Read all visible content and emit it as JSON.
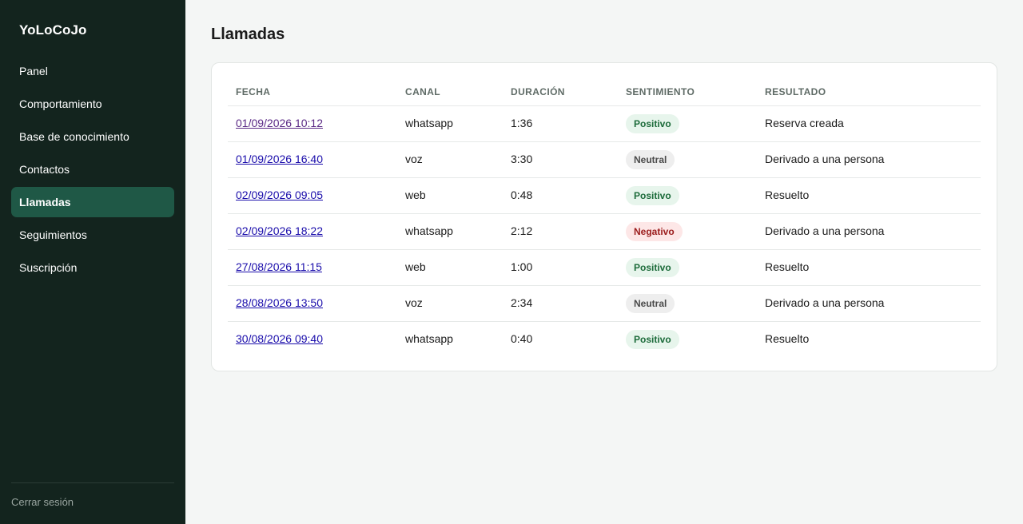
{
  "app": {
    "brand": "YoLoCoJo"
  },
  "sidebar": {
    "items": [
      {
        "label": "Panel",
        "active": false
      },
      {
        "label": "Comportamiento",
        "active": false
      },
      {
        "label": "Base de conocimiento",
        "active": false
      },
      {
        "label": "Contactos",
        "active": false
      },
      {
        "label": "Llamadas",
        "active": true
      },
      {
        "label": "Seguimientos",
        "active": false
      },
      {
        "label": "Suscripción",
        "active": false
      }
    ],
    "logout_label": "Cerrar sesión"
  },
  "main": {
    "title": "Llamadas",
    "table": {
      "headers": [
        "FECHA",
        "CANAL",
        "DURACIÓN",
        "SENTIMIENTO",
        "RESULTADO"
      ],
      "rows": [
        {
          "fecha": "01/09/2026 10:12",
          "canal": "whatsapp",
          "duracion": "1:36",
          "sentimiento": "Positivo",
          "resultado": "Reserva creada"
        },
        {
          "fecha": "01/09/2026 16:40",
          "canal": "voz",
          "duracion": "3:30",
          "sentimiento": "Neutral",
          "resultado": "Derivado a una persona"
        },
        {
          "fecha": "02/09/2026 09:05",
          "canal": "web",
          "duracion": "0:48",
          "sentimiento": "Positivo",
          "resultado": "Resuelto"
        },
        {
          "fecha": "02/09/2026 18:22",
          "canal": "whatsapp",
          "duracion": "2:12",
          "sentimiento": "Negativo",
          "resultado": "Derivado a una persona"
        },
        {
          "fecha": "27/08/2026 11:15",
          "canal": "web",
          "duracion": "1:00",
          "sentimiento": "Positivo",
          "resultado": "Resuelto"
        },
        {
          "fecha": "28/08/2026 13:50",
          "canal": "voz",
          "duracion": "2:34",
          "sentimiento": "Neutral",
          "resultado": "Derivado a una persona"
        },
        {
          "fecha": "30/08/2026 09:40",
          "canal": "whatsapp",
          "duracion": "0:40",
          "sentimiento": "Positivo",
          "resultado": "Resuelto"
        }
      ]
    }
  },
  "colors": {
    "sidebar_bg": "#13241e",
    "active_item": "#1f5846",
    "link": "#1a0dab",
    "link_visited": "#5b2a86",
    "positivo": "#1c6b3a",
    "neutral": "#4a4a4a",
    "negativo": "#9b1c1c"
  }
}
